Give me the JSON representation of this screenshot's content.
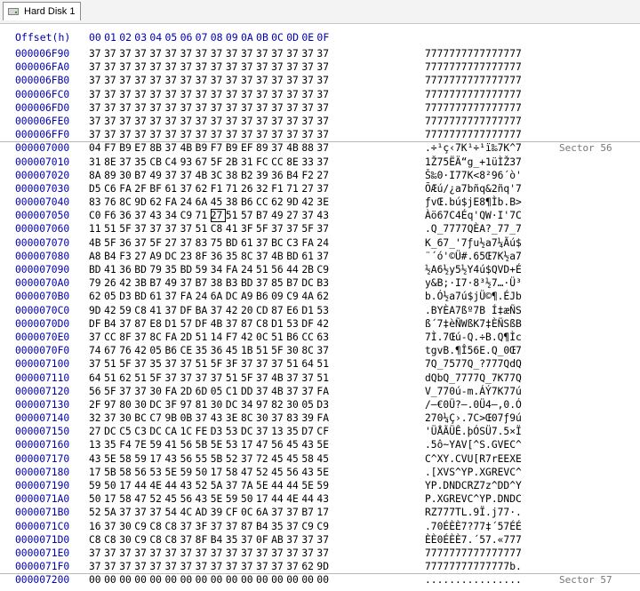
{
  "tab": {
    "label": "Hard Disk 1",
    "icon": "hard-disk-icon"
  },
  "header": {
    "offset_label": "Offset(h)",
    "columns": [
      "00",
      "01",
      "02",
      "03",
      "04",
      "05",
      "06",
      "07",
      "08",
      "09",
      "0A",
      "0B",
      "0C",
      "0D",
      "0E",
      "0F"
    ]
  },
  "rows": [
    {
      "offset": "000006F90",
      "hex": "37 37 37 37 37 37 37 37 37 37 37 37 37 37 37 37",
      "ascii": "7777777777777777",
      "sector": ""
    },
    {
      "offset": "000006FA0",
      "hex": "37 37 37 37 37 37 37 37 37 37 37 37 37 37 37 37",
      "ascii": "7777777777777777",
      "sector": ""
    },
    {
      "offset": "000006FB0",
      "hex": "37 37 37 37 37 37 37 37 37 37 37 37 37 37 37 37",
      "ascii": "7777777777777777",
      "sector": ""
    },
    {
      "offset": "000006FC0",
      "hex": "37 37 37 37 37 37 37 37 37 37 37 37 37 37 37 37",
      "ascii": "7777777777777777",
      "sector": ""
    },
    {
      "offset": "000006FD0",
      "hex": "37 37 37 37 37 37 37 37 37 37 37 37 37 37 37 37",
      "ascii": "7777777777777777",
      "sector": ""
    },
    {
      "offset": "000006FE0",
      "hex": "37 37 37 37 37 37 37 37 37 37 37 37 37 37 37 37",
      "ascii": "7777777777777777",
      "sector": ""
    },
    {
      "offset": "000006FF0",
      "hex": "37 37 37 37 37 37 37 37 37 37 37 37 37 37 37 37",
      "ascii": "7777777777777777",
      "sector": ""
    },
    {
      "offset": "000007000",
      "hex": "04 F7 B9 E7 8B 37 4B B9 F7 B9 EF 89 37 4B 88 37",
      "ascii": ".÷¹ç‹7K¹÷¹ï‰7K^7",
      "sector": "Sector 56",
      "boundary": true
    },
    {
      "offset": "000007010",
      "hex": "31 8E 37 35 CB C4 93 67 5F 2B 31 FC CC 8E 33 37",
      "ascii": "1Ž75ËÄ“g_+1üÌŽ37",
      "sector": ""
    },
    {
      "offset": "000007020",
      "hex": "8A 89 30 B7 49 37 37 4B 3C 38 B2 39 36 B4 F2 27",
      "ascii": "Š‰0·I77K<8²96´ò'",
      "sector": ""
    },
    {
      "offset": "000007030",
      "hex": "D5 C6 FA 2F BF 61 37 62 F1 71 26 32 F1 71 27 37",
      "ascii": "ÕÆú/¿a7bñq&2ñq'7",
      "sector": ""
    },
    {
      "offset": "000007040",
      "hex": "83 76 8C 9D 62 FA 24 6A 45 38 B6 CC 62 9D 42 3E",
      "ascii": "ƒvŒ.bú$jE8¶Ìb.B>",
      "sector": ""
    },
    {
      "offset": "000007050",
      "hex": "C0 F6 36 37 43 34 C9 71 27 51 57 B7 49 27 37 43",
      "ascii": "Àö67C4Éq'QW·I'7C",
      "sector": ""
    },
    {
      "offset": "000007060",
      "hex": "11 51 5F 37 37 37 37 51 C8 41 3F 5F 37 37 5F 37",
      "ascii": ".Q_7777QÈA?_77_7",
      "sector": ""
    },
    {
      "offset": "000007070",
      "hex": "4B 5F 36 37 5F 27 37 83 75 BD 61 37 BC C3 FA 24",
      "ascii": "K_67_'7ƒu½a7¼Ãú$",
      "sector": ""
    },
    {
      "offset": "000007080",
      "hex": "A8 B4 F3 27 A9 DC 23 8F 36 35 8C 37 4B BD 61 37",
      "ascii": "¨´ó'©Ü#.65Œ7K½a7",
      "sector": ""
    },
    {
      "offset": "000007090",
      "hex": "BD 41 36 BD 79 35 BD 59 34 FA 24 51 56 44 2B C9",
      "ascii": "½A6½y5½Y4ú$QVD+É",
      "sector": ""
    },
    {
      "offset": "0000070A0",
      "hex": "79 26 42 3B B7 49 37 B7 38 B3 BD 37 85 B7 DC B3",
      "ascii": "y&B;·I7·8³½7…·Ü³",
      "sector": ""
    },
    {
      "offset": "0000070B0",
      "hex": "62 05 D3 BD 61 37 FA 24 6A DC A9 B6 09 C9 4A 62",
      "ascii": "b.Ó½a7ú$jÜ©¶.ÉJb",
      "sector": ""
    },
    {
      "offset": "0000070C0",
      "hex": "9D 42 59 C8 41 37 DF BA 37 42 20 CD 87 E6 D1 53",
      "ascii": ".BYÈA7ßº7B Í‡æÑS",
      "sector": ""
    },
    {
      "offset": "0000070D0",
      "hex": "DF B4 37 87 E8 D1 57 DF 4B 37 87 C8 D1 53 DF 42",
      "ascii": "ß´7‡èÑWßK7‡ÈÑSßB",
      "sector": ""
    },
    {
      "offset": "0000070E0",
      "hex": "37 CC 8F 37 8C FA 2D 51 14 F7 42 0C 51 B6 CC 63",
      "ascii": "7Ì.7Œú-Q.÷B.Q¶Ìc",
      "sector": ""
    },
    {
      "offset": "0000070F0",
      "hex": "74 67 76 42 05 B6 CE 35 36 45 1B 51 5F 30 8C 37",
      "ascii": "tgvB.¶Î56E.Q_0Œ7",
      "sector": ""
    },
    {
      "offset": "000007100",
      "hex": "37 51 5F 37 35 37 37 51 5F 3F 37 37 37 51 64 51",
      "ascii": "7Q_7577Q_?777QdQ",
      "sector": ""
    },
    {
      "offset": "000007110",
      "hex": "64 51 62 51 5F 37 37 37 37 51 5F 37 4B 37 37 51",
      "ascii": "dQbQ_7777Q_7K77Q",
      "sector": ""
    },
    {
      "offset": "000007120",
      "hex": "56 5F 37 37 30 FA 2D 6D 05 C1 DD 37 4B 37 37 FA",
      "ascii": "V_770ú-m.ÁÝ7K77ú",
      "sector": ""
    },
    {
      "offset": "000007130",
      "hex": "2F 97 80 30 DC 3F 97 81 30 DC 34 97 82 30 05 D3",
      "ascii": "/—€0Ü?—.0Ü4—‚0.Ó",
      "sector": ""
    },
    {
      "offset": "000007140",
      "hex": "32 37 30 BC C7 9B 0B 37 43 3E 8C 30 37 83 39 FA",
      "ascii": "270¼Ç›.7C>Œ07ƒ9ú",
      "sector": ""
    },
    {
      "offset": "000007150",
      "hex": "27 DC C5 C3 DC CA 1C FE D3 53 DC 37 13 35 D7 CF",
      "ascii": "'ÜÅÃÜÊ.þÓSÜ7.5×Ï",
      "sector": ""
    },
    {
      "offset": "000007160",
      "hex": "13 35 F4 7E 59 41 56 5B 5E 53 17 47 56 45 43 5E",
      "ascii": ".5ô~YAV[^S.GVEC^",
      "sector": ""
    },
    {
      "offset": "000007170",
      "hex": "43 5E 58 59 17 43 56 55 5B 52 37 72 45 45 58 45",
      "ascii": "C^XY.CVU[R7rEEXE",
      "sector": ""
    },
    {
      "offset": "000007180",
      "hex": "17 5B 58 56 53 5E 59 50 17 58 47 52 45 56 43 5E",
      "ascii": ".[XVS^YP.XGREVC^",
      "sector": ""
    },
    {
      "offset": "000007190",
      "hex": "59 50 17 44 4E 44 43 52 5A 37 7A 5E 44 44 5E 59",
      "ascii": "YP.DNDCRZ7z^DD^Y",
      "sector": ""
    },
    {
      "offset": "0000071A0",
      "hex": "50 17 58 47 52 45 56 43 5E 59 50 17 44 4E 44 43",
      "ascii": "P.XGREVC^YP.DNDC",
      "sector": ""
    },
    {
      "offset": "0000071B0",
      "hex": "52 5A 37 37 37 54 4C AD 39 CF 0C 6A 37 37 B7 17",
      "ascii": "RZ777TL.9Ï.j77·.",
      "sector": ""
    },
    {
      "offset": "0000071C0",
      "hex": "16 37 30 C9 C8 C8 37 3F 37 37 87 B4 35 37 C9 C9",
      "ascii": ".70ÉÈÈ7?77‡´57ÉÉ",
      "sector": ""
    },
    {
      "offset": "0000071D0",
      "hex": "C8 C8 30 C9 C8 C8 37 8F B4 35 37 0F AB 37 37 37",
      "ascii": "ÈÈ0ÉÈÈ7.´57.«777",
      "sector": ""
    },
    {
      "offset": "0000071E0",
      "hex": "37 37 37 37 37 37 37 37 37 37 37 37 37 37 37 37",
      "ascii": "7777777777777777",
      "sector": ""
    },
    {
      "offset": "0000071F0",
      "hex": "37 37 37 37 37 37 37 37 37 37 37 37 37 37 62 9D",
      "ascii": "77777777777777b.",
      "sector": ""
    },
    {
      "offset": "000007200",
      "hex": "00 00 00 00 00 00 00 00 00 00 00 00 00 00 00 00",
      "ascii": "................",
      "sector": "Sector 57",
      "boundary": true
    }
  ]
}
